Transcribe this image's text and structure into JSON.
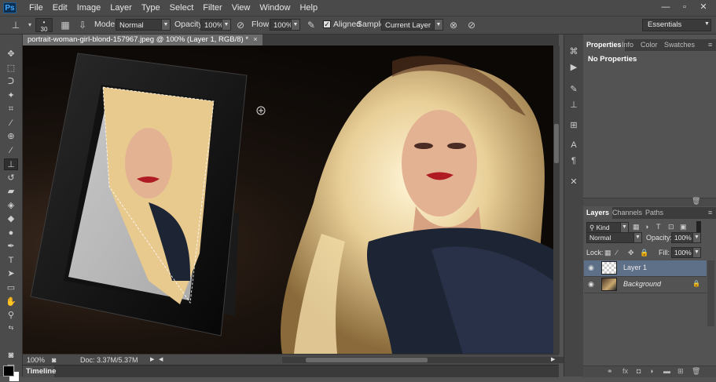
{
  "app": {
    "logo": "Ps"
  },
  "menu": [
    "File",
    "Edit",
    "Image",
    "Layer",
    "Type",
    "Select",
    "Filter",
    "View",
    "Window",
    "Help"
  ],
  "window_controls": {
    "minimize": "—",
    "restore": "▫",
    "close": "✕"
  },
  "options": {
    "brush_size": "30",
    "mode_label": "Mode:",
    "mode_value": "Normal",
    "opacity_label": "Opacity:",
    "opacity_value": "100%",
    "flow_label": "Flow:",
    "flow_value": "100%",
    "aligned_label": "Aligned",
    "aligned_checked": true,
    "sample_label": "Sample:",
    "sample_value": "Current Layer",
    "workspace": "Essentials"
  },
  "document": {
    "tab_title": "portrait-woman-girl-blond-157967.jpeg @ 100% (Layer 1, RGB/8) *",
    "close_glyph": "×",
    "zoom": "100%",
    "doc_size": "Doc: 3.37M/5.37M",
    "timeline_label": "Timeline"
  },
  "properties_panel": {
    "tabs": [
      "Properties",
      "Info",
      "Color",
      "Swatches"
    ],
    "active_tab": "Properties",
    "content": "No Properties"
  },
  "layers_panel": {
    "tabs": [
      "Layers",
      "Channels",
      "Paths"
    ],
    "active_tab": "Layers",
    "filter_kind": "Kind",
    "blend_mode": "Normal",
    "opacity_label": "Opacity:",
    "opacity_value": "100%",
    "lock_label": "Lock:",
    "fill_label": "Fill:",
    "fill_value": "100%",
    "layers": [
      {
        "name": "Layer 1",
        "selected": true,
        "visible": true
      },
      {
        "name": "Background",
        "selected": false,
        "visible": true,
        "locked": true
      }
    ]
  },
  "colors": {
    "foreground": "#000000",
    "background": "#ffffff",
    "selected_layer": "#5e6f88"
  }
}
